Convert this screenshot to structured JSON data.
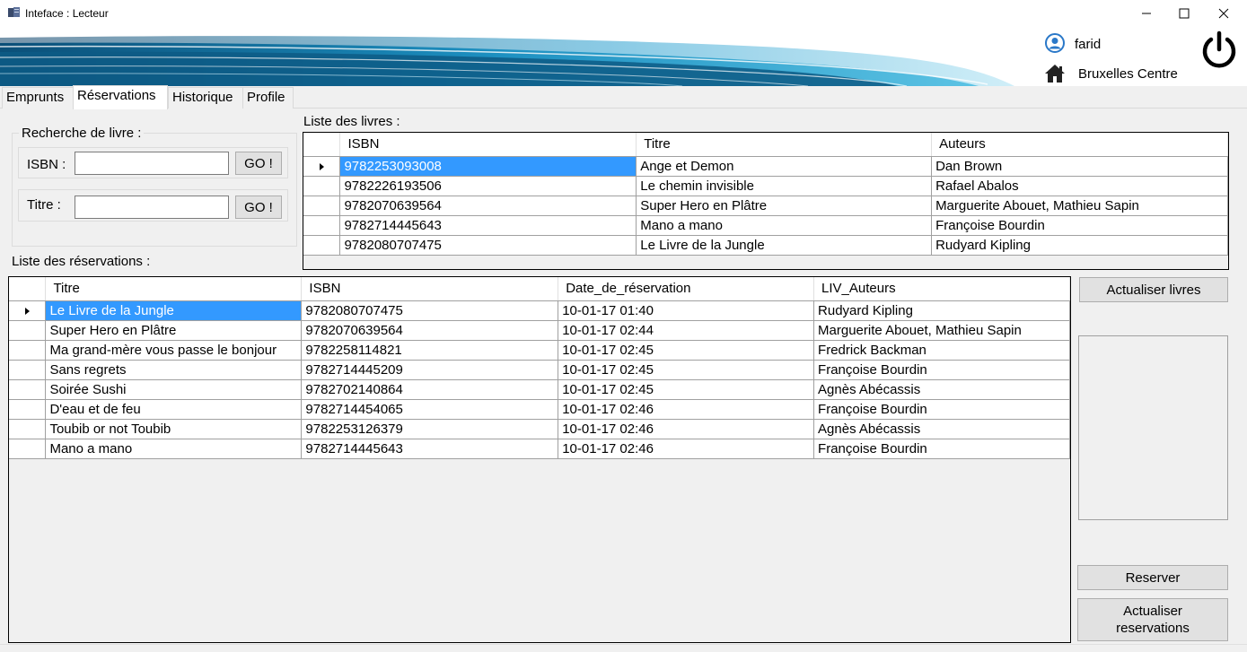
{
  "window": {
    "title": "Inteface : Lecteur"
  },
  "header": {
    "user": "farid",
    "location": "Bruxelles Centre"
  },
  "tabs": [
    {
      "label": "Emprunts"
    },
    {
      "label": "Réservations",
      "active": true
    },
    {
      "label": "Historique"
    },
    {
      "label": "Profile"
    }
  ],
  "search": {
    "group_title": "Recherche de livre :",
    "isbn_label": "ISBN :",
    "isbn_value": "",
    "titre_label": "Titre :",
    "titre_value": "",
    "go_label": "GO !"
  },
  "livres": {
    "section_label": "Liste des livres :",
    "columns": [
      "ISBN",
      "Titre",
      "Auteurs"
    ],
    "rows": [
      [
        "9782253093008",
        "Ange et Demon",
        "Dan Brown"
      ],
      [
        "9782226193506",
        "Le chemin invisible",
        "Rafael Abalos"
      ],
      [
        "9782070639564",
        "Super Hero en Plâtre",
        "Marguerite Abouet,  Mathieu Sapin"
      ],
      [
        "9782714445643",
        "Mano a mano",
        "Françoise Bourdin"
      ],
      [
        "9782080707475",
        "Le Livre de la Jungle",
        "Rudyard Kipling"
      ]
    ],
    "selected_row": 0
  },
  "reservations": {
    "section_label": "Liste des réservations :",
    "columns": [
      "Titre",
      "ISBN",
      "Date_de_réservation",
      "LIV_Auteurs"
    ],
    "rows": [
      [
        "Le Livre de la Jungle",
        "9782080707475",
        "10-01-17 01:40",
        "Rudyard Kipling"
      ],
      [
        "Super Hero en Plâtre",
        "9782070639564",
        "10-01-17 02:44",
        "Marguerite Abouet,  Mathieu Sapin"
      ],
      [
        "Ma grand-mère vous passe le bonjour",
        "9782258114821",
        "10-01-17 02:45",
        "Fredrick Backman"
      ],
      [
        "Sans regrets",
        "9782714445209",
        "10-01-17 02:45",
        "Françoise Bourdin"
      ],
      [
        "Soirée Sushi",
        "9782702140864",
        "10-01-17 02:45",
        "Agnès Abécassis"
      ],
      [
        "D'eau et de feu",
        "9782714454065",
        "10-01-17 02:46",
        "Françoise Bourdin"
      ],
      [
        "Toubib or not Toubib",
        "9782253126379",
        "10-01-17 02:46",
        "Agnès Abécassis"
      ],
      [
        "Mano a mano",
        "9782714445643",
        "10-01-17 02:46",
        "Françoise Bourdin"
      ]
    ],
    "selected_row": 0
  },
  "actions": {
    "actualiser_livres": "Actualiser livres",
    "reserver": "Reserver",
    "actualiser_reservations": "Actualiser reservations"
  },
  "icons": {
    "app": "book-icon",
    "user": "user-icon",
    "home": "home-icon",
    "power": "power-icon"
  },
  "colors": {
    "selection": "#3399ff",
    "banner_dark": "#0a5f8a",
    "banner_light": "#3fb0d8"
  }
}
